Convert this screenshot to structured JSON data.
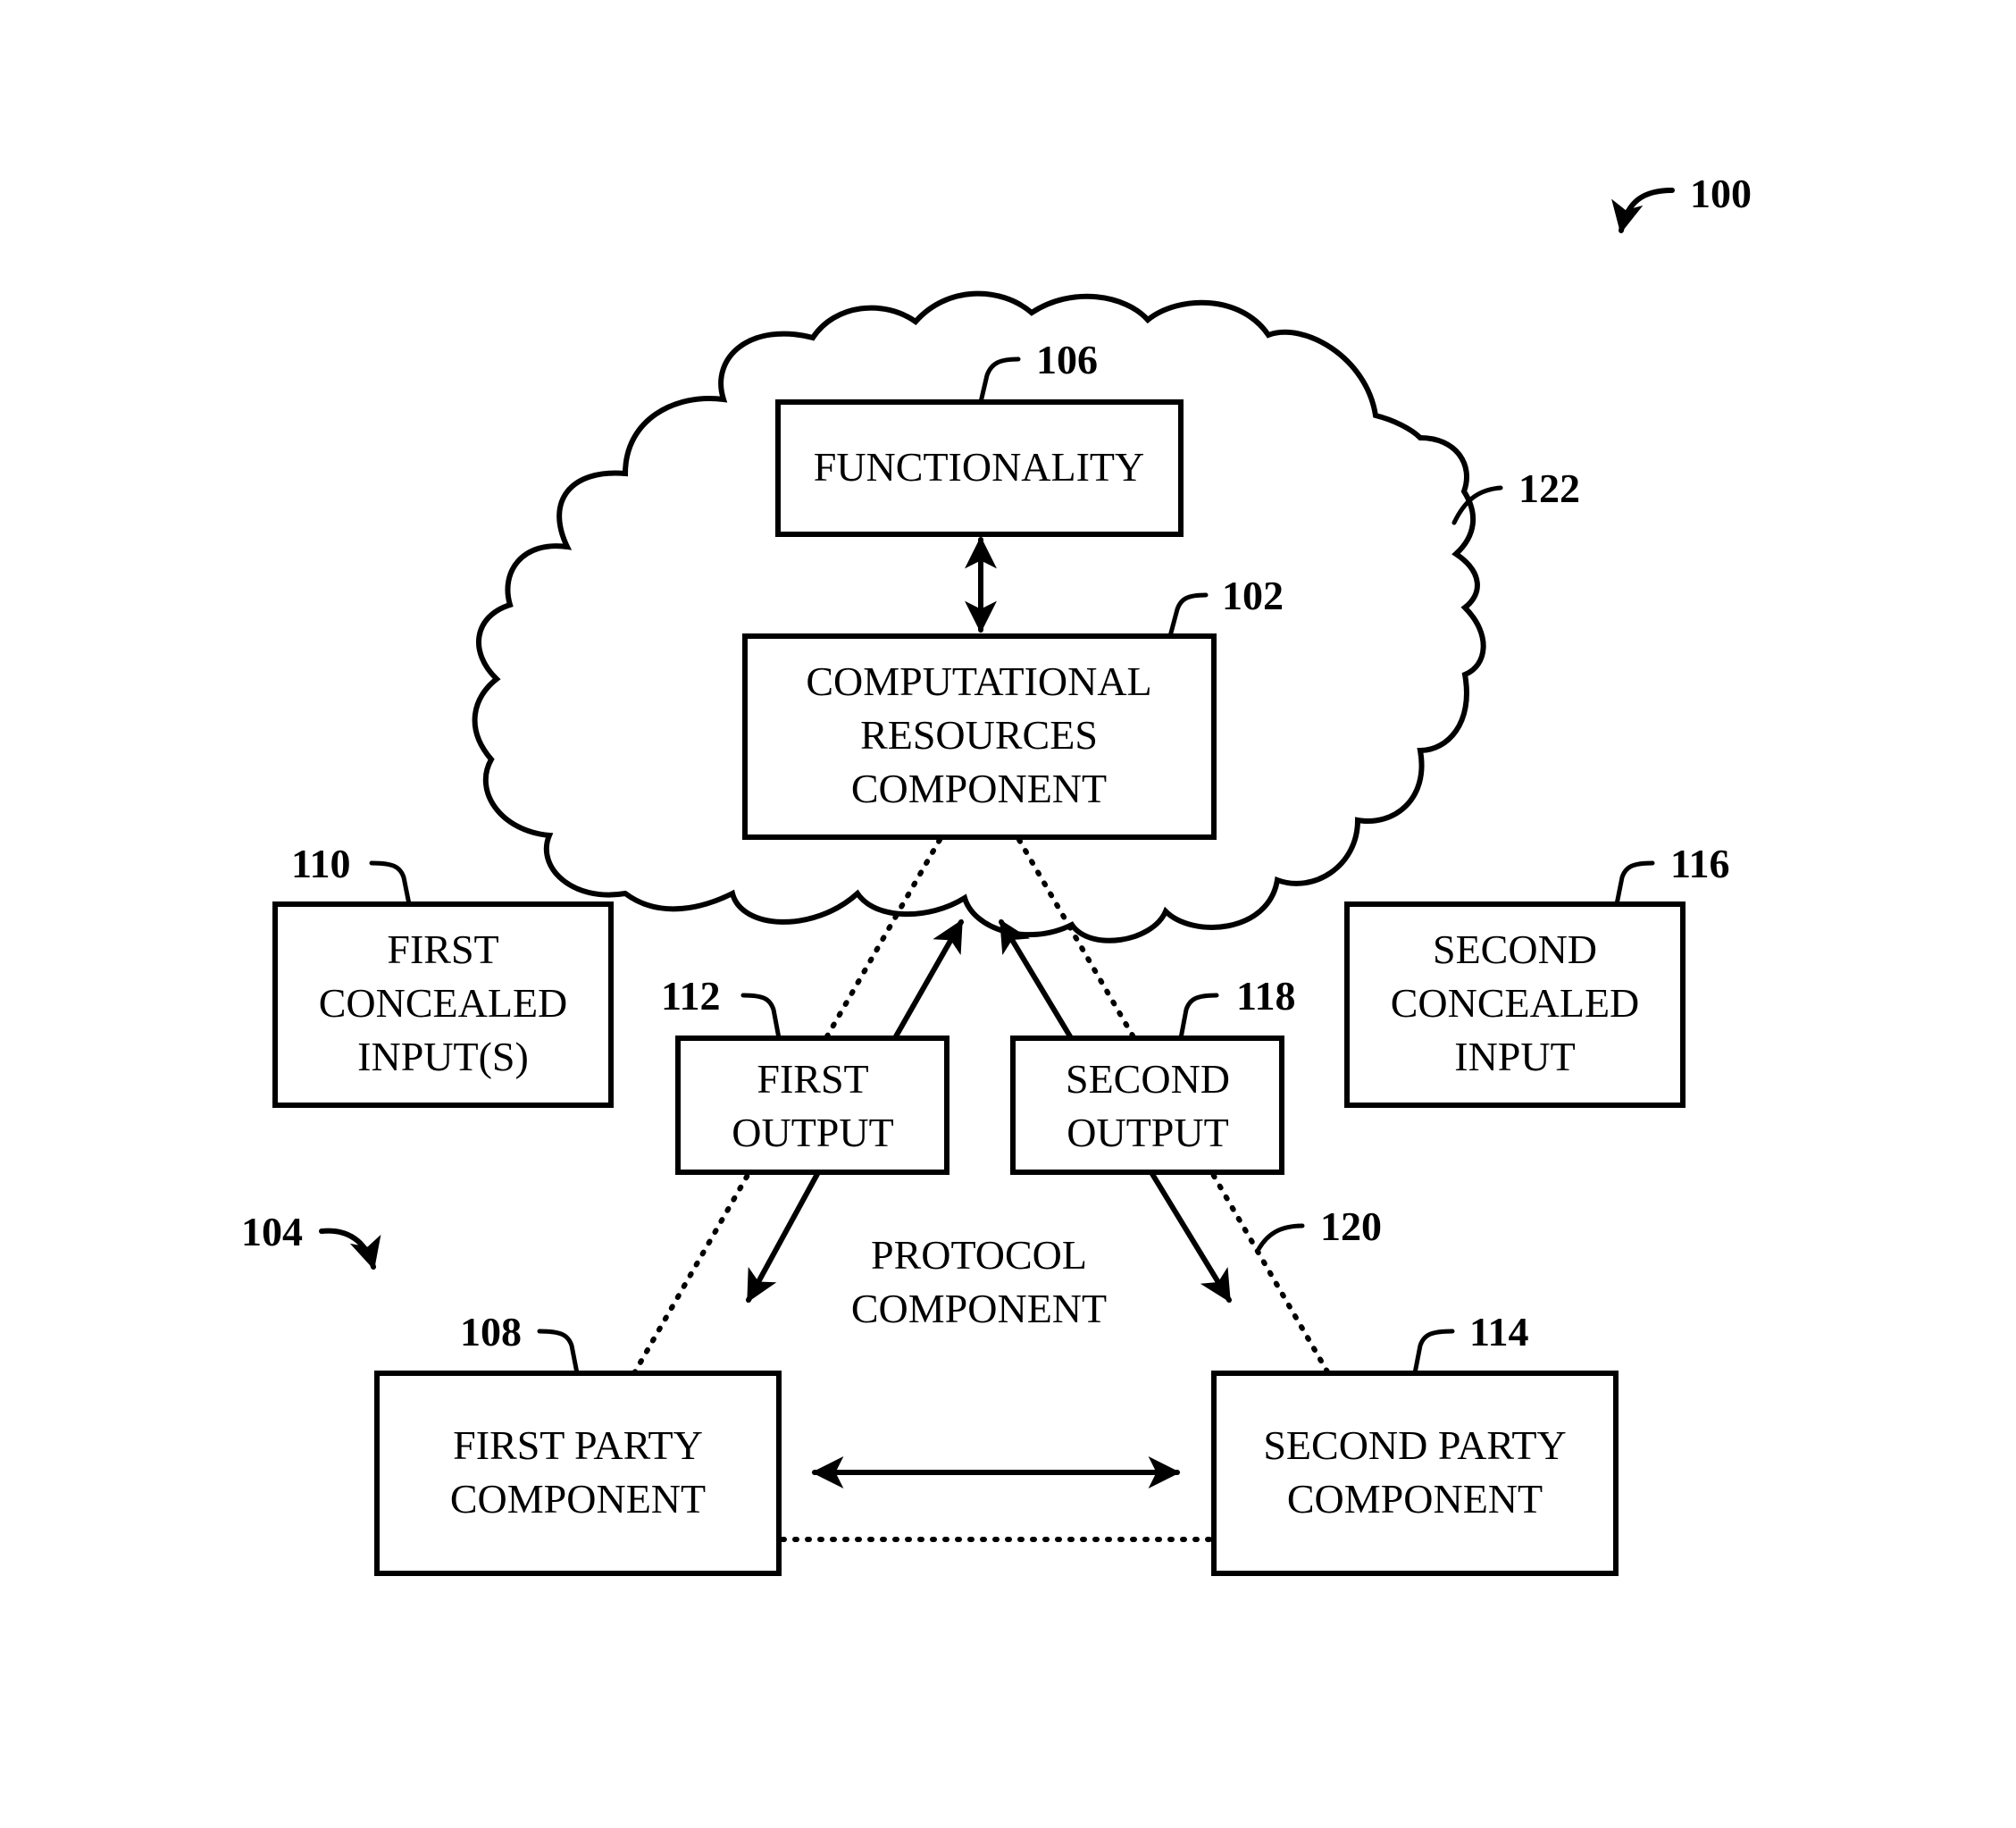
{
  "figure": {
    "reference": "100",
    "cloud": {
      "reference": "122"
    },
    "functionality": {
      "reference": "106",
      "lines": [
        "FUNCTIONALITY"
      ]
    },
    "computational_resources": {
      "reference": "102",
      "lines": [
        "COMPUTATIONAL",
        "RESOURCES",
        "COMPONENT"
      ]
    },
    "protocol_component": {
      "reference": "104",
      "lines": [
        "PROTOCOL",
        "COMPONENT"
      ]
    },
    "first_concealed_input": {
      "reference": "110",
      "lines": [
        "FIRST",
        "CONCEALED",
        "INPUT(S)"
      ]
    },
    "second_concealed_input": {
      "reference": "116",
      "lines": [
        "SECOND",
        "CONCEALED",
        "INPUT"
      ]
    },
    "first_output": {
      "reference": "112",
      "lines": [
        "FIRST",
        "OUTPUT"
      ]
    },
    "second_output": {
      "reference": "118",
      "lines": [
        "SECOND",
        "OUTPUT"
      ]
    },
    "first_party": {
      "reference": "108",
      "lines": [
        "FIRST PARTY",
        "COMPONENT"
      ]
    },
    "second_party": {
      "reference": "114",
      "lines": [
        "SECOND PARTY",
        "COMPONENT"
      ]
    },
    "communication_link": {
      "reference": "120"
    }
  }
}
